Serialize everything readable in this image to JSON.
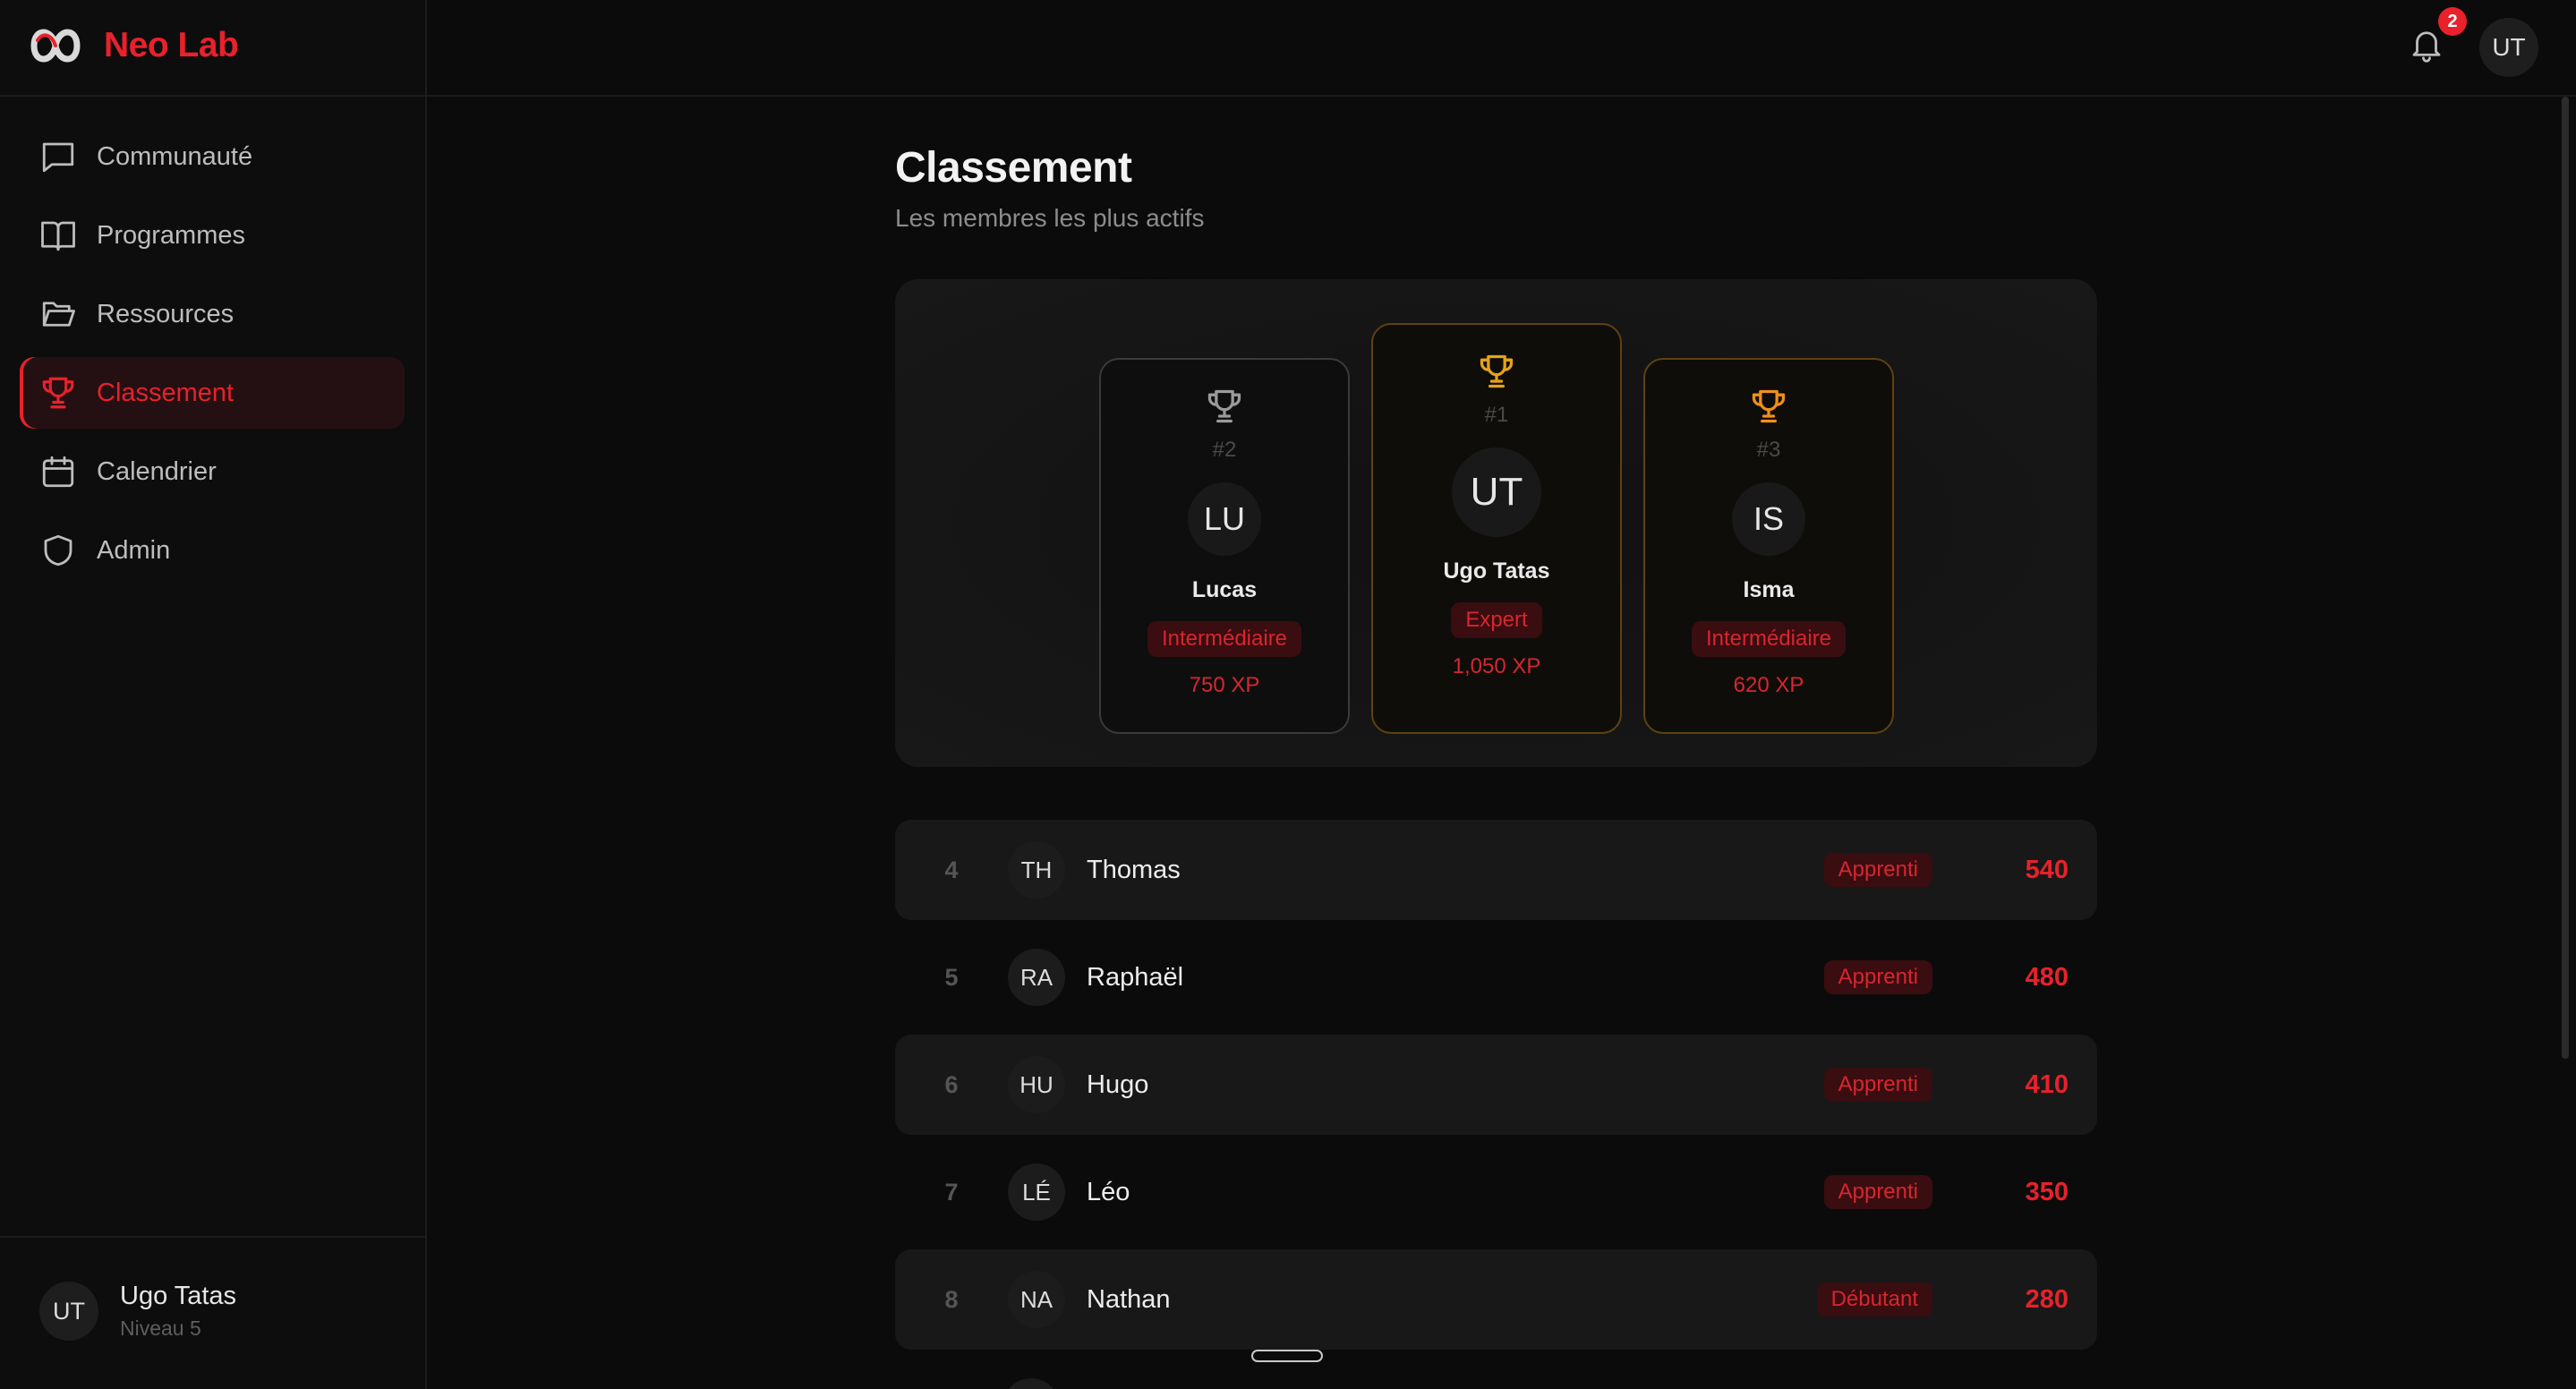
{
  "brand": {
    "name": "Neo Lab"
  },
  "nav": {
    "items": [
      {
        "label": "Communauté",
        "icon": "message-square-icon"
      },
      {
        "label": "Programmes",
        "icon": "book-open-icon"
      },
      {
        "label": "Ressources",
        "icon": "folder-open-icon"
      },
      {
        "label": "Classement",
        "icon": "trophy-icon",
        "active": true
      },
      {
        "label": "Calendrier",
        "icon": "calendar-icon"
      },
      {
        "label": "Admin",
        "icon": "shield-icon"
      }
    ]
  },
  "sidebar_user": {
    "initials": "UT",
    "name": "Ugo Tatas",
    "level": "Niveau 5"
  },
  "topbar": {
    "notifications": "2",
    "avatar_initials": "UT"
  },
  "page": {
    "title": "Classement",
    "subtitle": "Les membres les plus actifs"
  },
  "podium": {
    "first": {
      "rank": "#1",
      "initials": "UT",
      "name": "Ugo Tatas",
      "level": "Expert",
      "xp": "1,050 XP"
    },
    "second": {
      "rank": "#2",
      "initials": "LU",
      "name": "Lucas",
      "level": "Intermédiaire",
      "xp": "750 XP"
    },
    "third": {
      "rank": "#3",
      "initials": "IS",
      "name": "Isma",
      "level": "Intermédiaire",
      "xp": "620 XP"
    }
  },
  "ranking": [
    {
      "rank": "4",
      "initials": "TH",
      "name": "Thomas",
      "level": "Apprenti",
      "xp": "540"
    },
    {
      "rank": "5",
      "initials": "RA",
      "name": "Raphaël",
      "level": "Apprenti",
      "xp": "480"
    },
    {
      "rank": "6",
      "initials": "HU",
      "name": "Hugo",
      "level": "Apprenti",
      "xp": "410"
    },
    {
      "rank": "7",
      "initials": "LÉ",
      "name": "Léo",
      "level": "Apprenti",
      "xp": "350"
    },
    {
      "rank": "8",
      "initials": "NA",
      "name": "Nathan",
      "level": "Débutant",
      "xp": "280"
    }
  ],
  "colors": {
    "accent": "#e8212b",
    "gold": "#e6a219",
    "bronze": "#f08f1a",
    "silver": "#9a9a9a"
  }
}
